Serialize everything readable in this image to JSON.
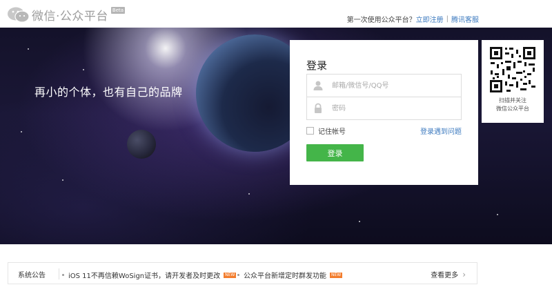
{
  "header": {
    "logo_text": "微信·公众平台",
    "beta": "Beta",
    "first_time_text": "第一次使用公众平台？",
    "register_link": "立即注册",
    "separator": "|",
    "support_link": "腾讯客服"
  },
  "banner": {
    "slogan": "再小的个体，也有自己的品牌"
  },
  "login": {
    "title": "登录",
    "account_placeholder": "邮箱/微信号/QQ号",
    "password_placeholder": "密码",
    "remember_label": "记住帐号",
    "problem_link": "登录遇到问题",
    "button_label": "登录"
  },
  "qr": {
    "line1": "扫描并关注",
    "line2": "微信公众平台"
  },
  "notice": {
    "label": "系统公告",
    "items": [
      {
        "text": "iOS 11不再信赖WoSign证书，请开发者及时更改",
        "badge": "NEW"
      },
      {
        "text": "公众平台新增定时群发功能",
        "badge": "NEW"
      }
    ],
    "more": "查看更多"
  },
  "colors": {
    "accent_green": "#44b549",
    "link_blue": "#3c7abf",
    "badge_orange": "#f37d2d"
  }
}
